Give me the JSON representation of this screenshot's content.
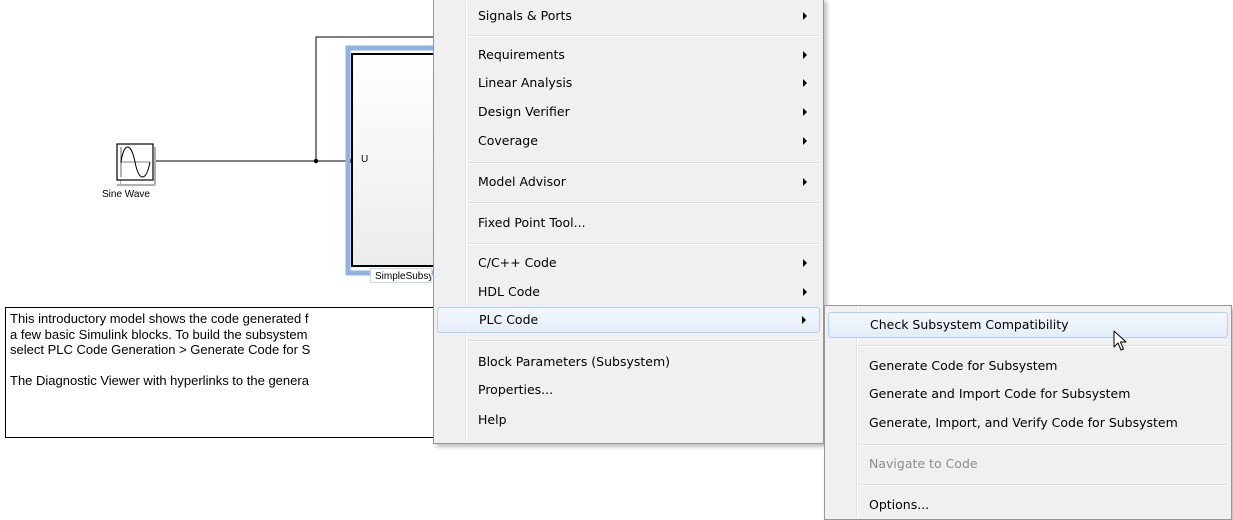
{
  "model": {
    "sine_block_label": "Sine Wave",
    "subsystem_label": "SimpleSubsystem",
    "input_port_label": "U",
    "annotation_lines": [
      "This introductory model shows the code generated f",
      "a few basic Simulink blocks.  To build the subsystem",
      "select PLC Code Generation > Generate Code for S",
      "",
      "The Diagnostic Viewer with hyperlinks to the genera"
    ]
  },
  "context_menu": {
    "items": [
      {
        "label": "Signals & Ports",
        "has_submenu": true
      },
      {
        "label": "Requirements",
        "has_submenu": true
      },
      {
        "label": "Linear Analysis",
        "has_submenu": true
      },
      {
        "label": "Design Verifier",
        "has_submenu": true
      },
      {
        "label": "Coverage",
        "has_submenu": true
      },
      {
        "label": "Model Advisor",
        "has_submenu": true
      },
      {
        "label": "Fixed Point Tool...",
        "has_submenu": false
      },
      {
        "label": "C/C++ Code",
        "has_submenu": true
      },
      {
        "label": "HDL Code",
        "has_submenu": true
      },
      {
        "label": "PLC Code",
        "has_submenu": true,
        "selected": true
      },
      {
        "label": "Block Parameters (Subsystem)",
        "has_submenu": false
      },
      {
        "label": "Properties...",
        "has_submenu": false
      },
      {
        "label": "Help",
        "has_submenu": false
      }
    ]
  },
  "plc_submenu": {
    "items": [
      {
        "label": "Check Subsystem Compatibility",
        "selected": true
      },
      {
        "label": "Generate Code for Subsystem"
      },
      {
        "label": "Generate and Import Code for Subsystem"
      },
      {
        "label": "Generate, Import, and Verify Code for Subsystem"
      },
      {
        "label": "Navigate to Code",
        "disabled": true
      },
      {
        "label": "Options..."
      }
    ]
  },
  "colors": {
    "menu_background": "#f0f0f0",
    "selection_border": "#aecff7",
    "block_selection": "#8fb3e3"
  },
  "cursor_icon": "arrow-pointer-icon"
}
